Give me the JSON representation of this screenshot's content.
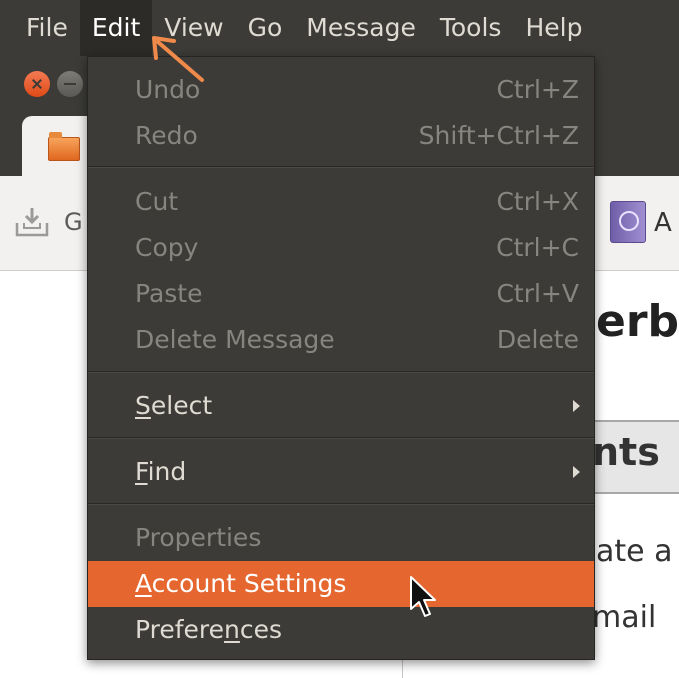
{
  "menubar": {
    "items": [
      "File",
      "Edit",
      "View",
      "Go",
      "Message",
      "Tools",
      "Help"
    ],
    "open_item": "Edit"
  },
  "toolbar": {
    "get_messages_label": "G",
    "address_book_label": "A"
  },
  "content": {
    "title": "erb",
    "accounts_heading": "nts",
    "create_text": "ate a n",
    "email_text": "mail"
  },
  "edit_menu": {
    "items": [
      {
        "label": "Undo",
        "shortcut": "Ctrl+Z",
        "enabled": false
      },
      {
        "label": "Redo",
        "shortcut": "Shift+Ctrl+Z",
        "enabled": false
      },
      {
        "label": "Cut",
        "shortcut": "Ctrl+X",
        "enabled": false
      },
      {
        "label": "Copy",
        "shortcut": "Ctrl+C",
        "enabled": false
      },
      {
        "label": "Paste",
        "shortcut": "Ctrl+V",
        "enabled": false
      },
      {
        "label": "Delete Message",
        "shortcut": "Delete",
        "enabled": false
      },
      {
        "label_pre": "",
        "mnemonic": "S",
        "label_post": "elect",
        "submenu": true,
        "enabled": true
      },
      {
        "label_pre": "",
        "mnemonic": "F",
        "label_post": "ind",
        "submenu": true,
        "enabled": true
      },
      {
        "label": "Properties",
        "enabled": false
      },
      {
        "label_pre": "",
        "mnemonic": "A",
        "label_post": "ccount Settings",
        "enabled": true,
        "highlighted": true
      },
      {
        "label_pre": "Prefere",
        "mnemonic": "n",
        "label_post": "ces",
        "enabled": true
      }
    ]
  },
  "colors": {
    "menubar_bg": "#3c3b37",
    "menu_text": "#dfdbd2",
    "menu_disabled_text": "#87857f",
    "highlight": "#e5672f",
    "annotation_arrow": "#f08a4b"
  },
  "icons": {
    "window_close": "close-icon",
    "window_minimize": "minimize-icon",
    "tab": "folder-icon",
    "get_messages": "download-tray-icon",
    "address_book": "address-book-icon",
    "submenu": "chevron-right-icon",
    "pointer": "mouse-cursor-icon",
    "annotation": "arrow-annotation-icon"
  }
}
